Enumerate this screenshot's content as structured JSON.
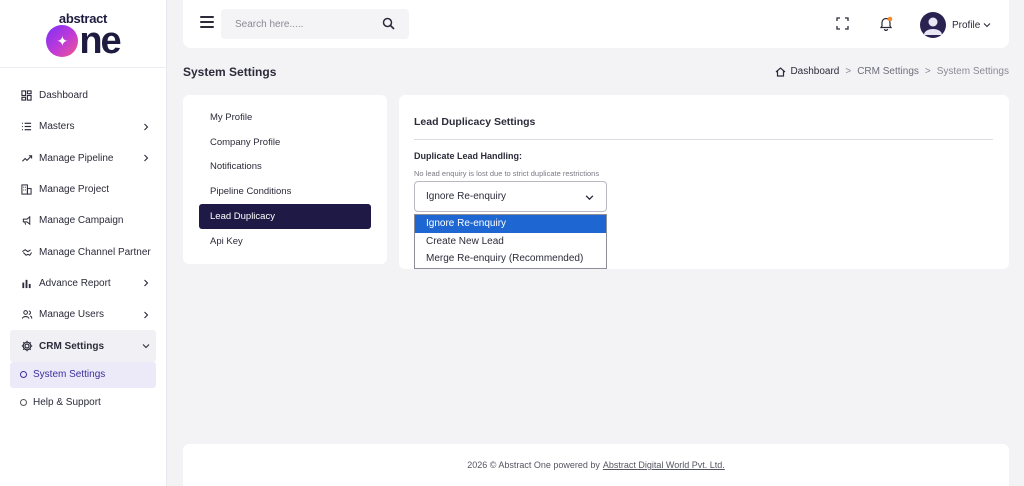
{
  "brand": {
    "logo_top": "abstract",
    "logo_main": "ne"
  },
  "sidebar": {
    "items": [
      {
        "label": "Dashboard",
        "icon": "dashboard-icon",
        "has_children": false
      },
      {
        "label": "Masters",
        "icon": "list-icon",
        "has_children": true
      },
      {
        "label": "Manage Pipeline",
        "icon": "pipeline-icon",
        "has_children": true
      },
      {
        "label": "Manage Project",
        "icon": "building-icon",
        "has_children": false
      },
      {
        "label": "Manage Campaign",
        "icon": "megaphone-icon",
        "has_children": false
      },
      {
        "label": "Manage Channel Partner",
        "icon": "handshake-icon",
        "has_children": false
      },
      {
        "label": "Advance Report",
        "icon": "bar-chart-icon",
        "has_children": true
      },
      {
        "label": "Manage Users",
        "icon": "users-icon",
        "has_children": true
      },
      {
        "label": "CRM Settings",
        "icon": "gear-icon",
        "has_children": true,
        "expanded": true
      }
    ],
    "sub_items": [
      {
        "label": "System Settings",
        "active": true
      }
    ],
    "help": "Help & Support"
  },
  "topbar": {
    "search_placeholder": "Search here.....",
    "profile_label": "Profile"
  },
  "page": {
    "title": "System Settings",
    "breadcrumb": [
      "Dashboard",
      "CRM Settings",
      "System Settings"
    ]
  },
  "settings_menu": {
    "items": [
      "My Profile",
      "Company Profile",
      "Notifications",
      "Pipeline Conditions",
      "Lead Duplicacy",
      "Api Key"
    ],
    "active_index": 4
  },
  "content": {
    "title": "Lead Duplicacy Settings",
    "field_label": "Duplicate Lead Handling:",
    "field_help": "No lead enquiry is lost due to strict duplicate restrictions",
    "selected_value": "Ignore Re-enquiry",
    "options": [
      "Ignore Re-enquiry",
      "Create New Lead",
      "Merge Re-enquiry (Recommended)"
    ],
    "highlighted_index": 0
  },
  "footer": {
    "text": "2026 © Abstract One powered by",
    "link": "Abstract Digital World Pvt. Ltd."
  },
  "colors": {
    "primary_dark": "#1f1a45",
    "option_highlight": "#1e67d3",
    "active_sub_bg": "#eceaf8",
    "notification_dot": "#f28b2e"
  }
}
